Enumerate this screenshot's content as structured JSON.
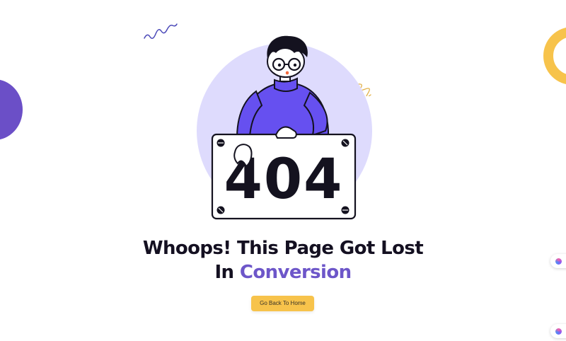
{
  "headline": {
    "line1": "Whoops! This Page Got Lost",
    "line2_prefix": "In ",
    "line2_accent": "Conversion"
  },
  "illustration": {
    "sign_text": "404"
  },
  "cta": {
    "label": "Go Back To Home"
  },
  "colors": {
    "accent": "#6d56c9",
    "button": "#f7c34b",
    "circle_bg": "#dedbfd",
    "sweater": "#6650f0",
    "ring": "#f7c34b",
    "left_blob": "#6b4fc7"
  },
  "icons": {
    "float_widget_1": "assistant-icon",
    "float_widget_2": "assistant-icon"
  }
}
